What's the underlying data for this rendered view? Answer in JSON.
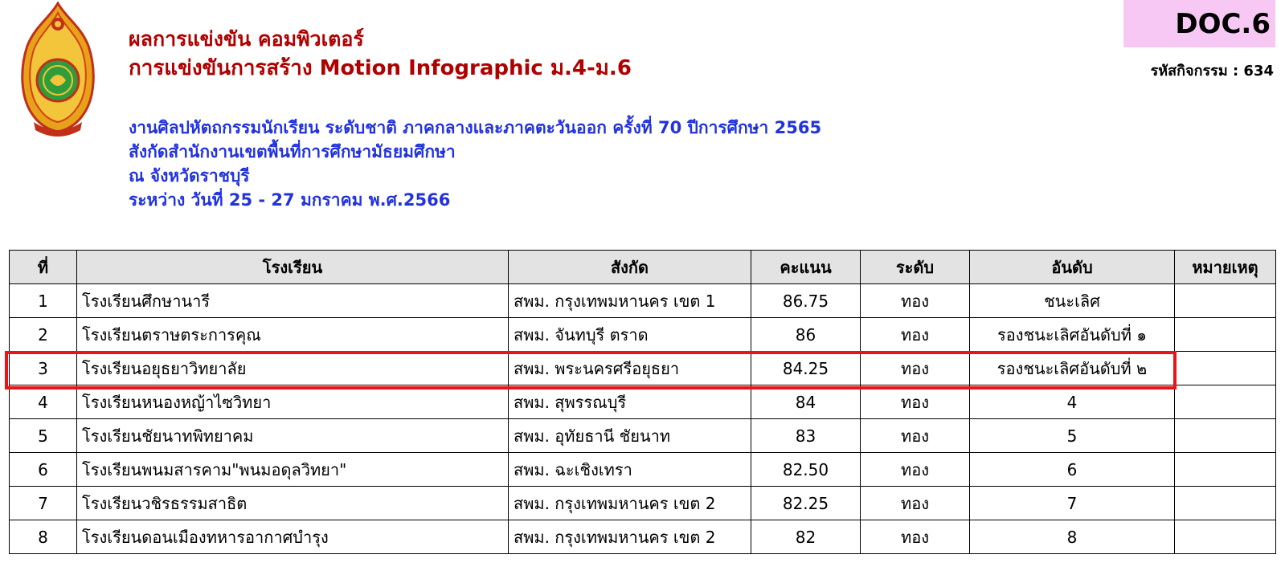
{
  "header": {
    "title_line1": "ผลการแข่งขัน คอมพิวเตอร์",
    "title_line2": "การแข่งขันการสร้าง Motion Infographic ม.4-ม.6",
    "doc_label": "DOC.6",
    "activity_code": "รหัสกิจกรรม : 634",
    "subtitle_lines": [
      "งานศิลปหัตถกรรมนักเรียน ระดับชาติ ภาคกลางและภาคตะวันออก ครั้งที่ 70 ปีการศึกษา 2565",
      "สังกัดสำนักงานเขตพื้นที่การศึกษามัธยมศึกษา",
      "ณ จังหวัดราชบุรี",
      "ระหว่าง วันที่ 25 - 27 มกราคม พ.ศ.2566"
    ]
  },
  "colors": {
    "title": "#b00000",
    "subtitle": "#2233dd",
    "doc_box": "#f8c8f4",
    "highlight": "#e8141a",
    "header_bg": "#e3e3e3"
  },
  "table": {
    "headers": [
      "ที่",
      "โรงเรียน",
      "สังกัด",
      "คะแนน",
      "ระดับ",
      "อันดับ",
      "หมายเหตุ"
    ],
    "rows": [
      [
        "1",
        "โรงเรียนศึกษานารี",
        "สพม. กรุงเทพมหานคร เขต 1",
        "86.75",
        "ทอง",
        "ชนะเลิศ",
        ""
      ],
      [
        "2",
        "โรงเรียนตราษตระการคุณ",
        "สพม. จันทบุรี ตราด",
        "86",
        "ทอง",
        "รองชนะเลิศอันดับที่ ๑",
        ""
      ],
      [
        "3",
        "โรงเรียนอยุธยาวิทยาลัย",
        "สพม. พระนครศรีอยุธยา",
        "84.25",
        "ทอง",
        "รองชนะเลิศอันดับที่ ๒",
        ""
      ],
      [
        "4",
        "โรงเรียนหนองหญ้าไซวิทยา",
        "สพม. สุพรรณบุรี",
        "84",
        "ทอง",
        "4",
        ""
      ],
      [
        "5",
        "โรงเรียนชัยนาทพิทยาคม",
        "สพม. อุทัยธานี ชัยนาท",
        "83",
        "ทอง",
        "5",
        ""
      ],
      [
        "6",
        "โรงเรียนพนมสารคาม\"พนมอดุลวิทยา\"",
        "สพม. ฉะเชิงเทรา",
        "82.50",
        "ทอง",
        "6",
        ""
      ],
      [
        "7",
        "โรงเรียนวชิรธรรมสาธิต",
        "สพม. กรุงเทพมหานคร เขต 2",
        "82.25",
        "ทอง",
        "7",
        ""
      ],
      [
        "8",
        "โรงเรียนดอนเมืองทหารอากาศบำรุง",
        "สพม. กรุงเทพมหานคร เขต 2",
        "82",
        "ทอง",
        "8",
        ""
      ]
    ]
  }
}
